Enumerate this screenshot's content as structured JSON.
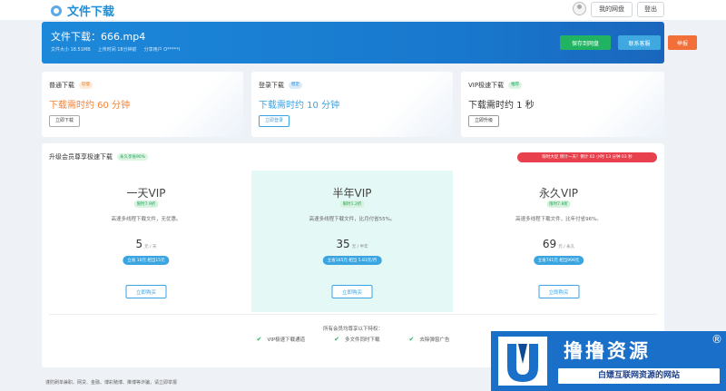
{
  "topbar": {
    "site_title": "文件下载",
    "netdisk_label": "我的网盘",
    "logout_label": "登出"
  },
  "file": {
    "title": "文件下载：666.mp4",
    "size": "文件大小 18.51MB",
    "upload_time": "上传时间 18分钟前",
    "sharer": "分享用户 O*****I",
    "save_label": "保存到网盘",
    "contact_label": "联系客服",
    "report_label": "举报"
  },
  "download_options": [
    {
      "title": "普通下载",
      "tag": "较慢",
      "time": "下载需时约 60 分钟",
      "button": "立即下载"
    },
    {
      "title": "登录下载",
      "tag": "稳定",
      "time": "下载需时约 10 分钟",
      "button": "立即登录"
    },
    {
      "title": "VIP极速下载",
      "tag": "推荐",
      "time": "下载需时约 1 秒",
      "button": "立即升级"
    }
  ],
  "vip": {
    "heading": "升级会员尊享极速下载",
    "heading_tag": "永久享省90%",
    "promo": "限时大促 倒计一天！倒计 02 小时 13 分钟 03 秒",
    "plans": [
      {
        "name": "一天VIP",
        "sub": "限时7.9折",
        "desc": "高速多线程下载文件，无优惠。",
        "price": "5",
        "unit": "元 / 天",
        "save": "立省 10元 相当15元",
        "buy": "立即购买"
      },
      {
        "name": "半年VIP",
        "sub": "限时1.2折",
        "desc": "高速多线程下载文件，比月付省55%。",
        "price": "35",
        "unit": "元 / 半年",
        "save": "立省165元 相当 5.83元/月",
        "buy": "立即购买"
      },
      {
        "name": "永久VIP",
        "sub": "限时7.8折",
        "desc": "高速多线程下载文件，比年付省96%。",
        "price": "69",
        "unit": "元 / 永久",
        "save": "立省741元 相当999元",
        "buy": "立即购买"
      }
    ],
    "perks_title": "所有会员均尊享以下特权：",
    "perks": [
      "VIP极速下载通道",
      "多文件同时下载",
      "去除弹窗广告"
    ]
  },
  "footer_note": "谨防刷单兼职、网贷、金融、博彩赌博、推博等诈骗，请立即举报",
  "watermark": {
    "title": "撸撸资源",
    "reg": "®",
    "subtitle": "白嫖互联网资源的网站"
  },
  "colors": {
    "brand_blue": "#1d8fd8",
    "green": "#21b361",
    "orange": "#f26f3a",
    "promo_red": "#e8414d"
  }
}
